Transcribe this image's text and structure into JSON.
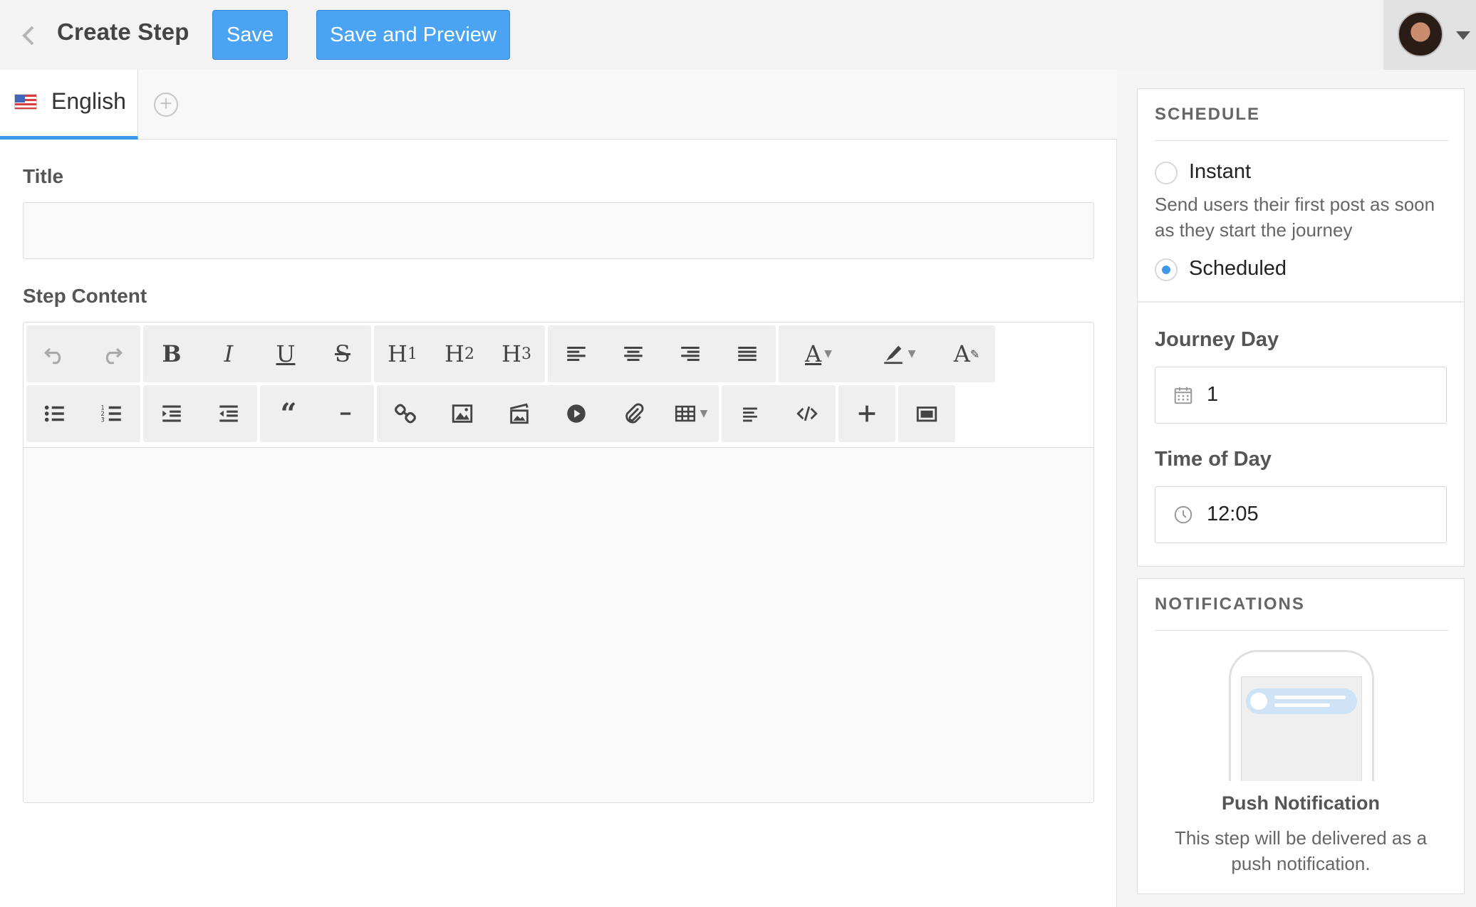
{
  "header": {
    "title": "Create Step",
    "save_label": "Save",
    "save_preview_label": "Save and Preview"
  },
  "tabs": [
    {
      "label": "English",
      "active": true
    }
  ],
  "form": {
    "title_label": "Title",
    "title_value": "",
    "content_label": "Step Content",
    "content_value": ""
  },
  "toolbar": {
    "row1": [
      "undo-icon",
      "redo-icon",
      "bold-icon",
      "italic-icon",
      "underline-icon",
      "strikethrough-icon",
      "h1-icon",
      "h2-icon",
      "h3-icon",
      "align-left-icon",
      "align-center-icon",
      "align-right-icon",
      "align-justify-icon",
      "text-color-icon",
      "highlight-icon",
      "clear-format-icon"
    ],
    "row2": [
      "bullet-list-icon",
      "numbered-list-icon",
      "indent-icon",
      "outdent-icon",
      "quote-icon",
      "horizontal-rule-icon",
      "link-icon",
      "image-icon",
      "gallery-icon",
      "video-icon",
      "attachment-icon",
      "table-icon",
      "paragraph-icon",
      "code-icon",
      "insert-icon",
      "fullscreen-icon"
    ]
  },
  "schedule": {
    "heading": "SCHEDULE",
    "instant_label": "Instant",
    "instant_desc": "Send users their first post as soon as they start the journey",
    "scheduled_label": "Scheduled",
    "selected": "Scheduled",
    "journey_day_label": "Journey Day",
    "journey_day_value": "1",
    "time_label": "Time of Day",
    "time_value": "12:05"
  },
  "notifications": {
    "heading": "NOTIFICATIONS",
    "title": "Push Notification",
    "desc": "This step will be delivered as a push notification."
  },
  "colors": {
    "accent": "#4aa3f3",
    "accent_border": "#2f86d6",
    "tab_underline": "#3f97e8"
  }
}
